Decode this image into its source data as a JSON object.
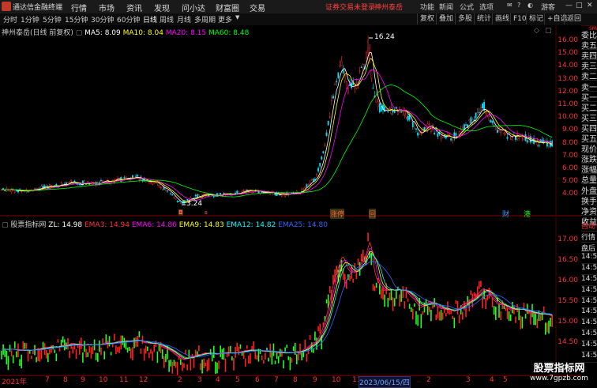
{
  "app": {
    "name": "通达信金融终端"
  },
  "menu": [
    {
      "label": "行情"
    },
    {
      "label": "市场"
    },
    {
      "label": "资讯"
    },
    {
      "label": "发现"
    },
    {
      "label": "问小达"
    },
    {
      "label": "财富圈"
    },
    {
      "label": "交易"
    }
  ],
  "login": {
    "text": "证券交易未登录",
    "stock": "神州泰岳"
  },
  "window_controls": {
    "func": "功能",
    "news": "新闻",
    "formula": "公式",
    "options": "选项",
    "guest": "游客"
  },
  "periods": [
    "分时",
    "1分钟",
    "5分钟",
    "15分钟",
    "30分钟",
    "60分钟",
    "日线",
    "周线",
    "月线",
    "多周期",
    "更多"
  ],
  "active_period": "日线",
  "toolbar_buttons": [
    "复权",
    "叠加",
    "多股",
    "统计",
    "画线",
    "F10",
    "标记",
    "+自选",
    "返回"
  ],
  "main_chart": {
    "title": "神州泰岳(日线 前复权)",
    "ma": [
      {
        "label": "MA5: 8.09",
        "color": "#ffffff"
      },
      {
        "label": "MA10: 8.04",
        "color": "#ffff00"
      },
      {
        "label": "MA20: 8.15",
        "color": "#ff00ff"
      },
      {
        "label": "MA60: 8.48",
        "color": "#00ff00"
      }
    ],
    "yticks": [
      "16.00",
      "15.00",
      "14.00",
      "13.00",
      "12.00",
      "11.00",
      "10.00",
      "9.00",
      "8.00",
      "7.00",
      "6.00",
      "5.00",
      "4.00"
    ],
    "high_label": "16.24",
    "low_label": "3.24",
    "markers": [
      {
        "label": "涨停",
        "color": "#ff6040"
      },
      {
        "label": "回",
        "color": "#ff6040"
      },
      {
        "label": "财",
        "color": "#3399ff"
      },
      {
        "label": "港",
        "color": "#00ff00"
      }
    ]
  },
  "sub_chart": {
    "title": "股票指标网",
    "zl": "ZL: 14.98",
    "emas": [
      {
        "label": "EMA3: 14.94",
        "color": "#ff3030"
      },
      {
        "label": "EMA6: 14.86",
        "color": "#ff00ff"
      },
      {
        "label": "EMA9: 14.83",
        "color": "#ffff00"
      },
      {
        "label": "EMA12: 14.82",
        "color": "#00ffff"
      },
      {
        "label": "EMA25: 14.80",
        "color": "#3366ff"
      }
    ],
    "yticks": [
      "17.00",
      "16.50",
      "16.00",
      "15.50",
      "15.00",
      "14.50"
    ]
  },
  "right_panel": {
    "top": [
      "委比",
      "卖五",
      "卖四",
      "卖三",
      "卖二",
      "卖一",
      "买一",
      "买二",
      "买三",
      "买四",
      "买五",
      "现价",
      "涨跌",
      "涨幅",
      "总量",
      "外盘",
      "换手",
      "净资",
      "收益"
    ],
    "bottom": [
      "自动",
      "行情",
      "盘后",
      "14:5",
      "14:5",
      "14:5",
      "14:5",
      "14:5",
      "14:5",
      "14:5",
      "14:5",
      "14:5",
      "14:5"
    ]
  },
  "x_axis": {
    "year": "2021年",
    "months": [
      "7",
      "8",
      "9",
      "10",
      "11",
      "12",
      "2",
      "3",
      "4",
      "5",
      "6",
      "7",
      "8",
      "9",
      "10",
      "11",
      "12",
      "2",
      "3",
      "4",
      "5"
    ],
    "date": "2023/06/15/四"
  },
  "watermark": {
    "title": "股票指标网",
    "url": "www.7gpzb.com"
  }
}
